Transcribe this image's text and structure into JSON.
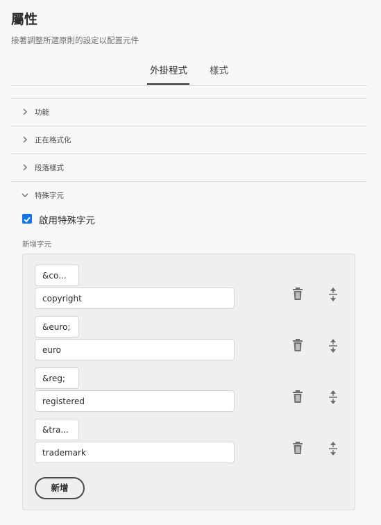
{
  "header": {
    "title": "屬性",
    "subtitle": "接著調整所選原則的設定以配置元件"
  },
  "tabs": [
    {
      "label": "外掛程式",
      "active": true
    },
    {
      "label": "樣式",
      "active": false
    }
  ],
  "sections": [
    {
      "label": "功能",
      "expanded": false
    },
    {
      "label": "正在格式化",
      "expanded": false
    },
    {
      "label": "段落樣式",
      "expanded": false
    },
    {
      "label": "特殊字元",
      "expanded": true
    }
  ],
  "special_chars": {
    "enable_label": "啟用特殊字元",
    "enable_checked": true,
    "field_label": "新增字元",
    "entries": [
      {
        "code": "&co...",
        "name": "copyright"
      },
      {
        "code": "&euro;",
        "name": "euro"
      },
      {
        "code": "&reg;",
        "name": "registered"
      },
      {
        "code": "&tra...",
        "name": "trademark"
      }
    ],
    "add_label": "新增"
  },
  "colors": {
    "accent": "#1473e6",
    "text": "#2c2c2c",
    "muted": "#6e6e6e"
  }
}
